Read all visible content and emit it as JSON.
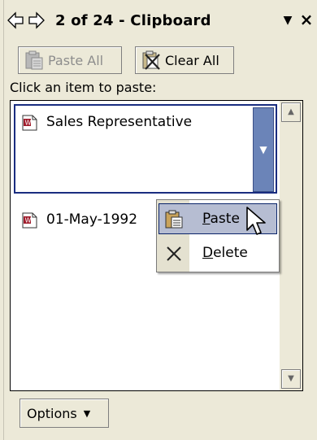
{
  "titlebar": {
    "back_icon": "arrow-left-icon",
    "forward_icon": "arrow-right-icon",
    "title": "2 of 24 - Clipboard",
    "menu_glyph": "▼",
    "close_glyph": "×"
  },
  "toolbar": {
    "paste_all_label": "Paste All",
    "paste_all_enabled": false,
    "clear_all_label": "Clear All"
  },
  "instruction": "Click an item to paste:",
  "items": [
    {
      "label": "Sales Representative",
      "icon": "word-clip-icon",
      "selected": true
    },
    {
      "label": "01-May-1992",
      "icon": "word-clip-icon",
      "selected": false
    }
  ],
  "context_menu": {
    "paste_label": "Paste",
    "paste_access_key": "P",
    "delete_label": "Delete",
    "delete_access_key": "D",
    "highlighted": "Paste"
  },
  "footer": {
    "options_label": "Options"
  },
  "colors": {
    "panel_bg": "#ece9d8",
    "selection_border": "#1a2d80",
    "dropdown_blue": "#6b84b8",
    "menu_highlight": "#b6bdd2"
  }
}
